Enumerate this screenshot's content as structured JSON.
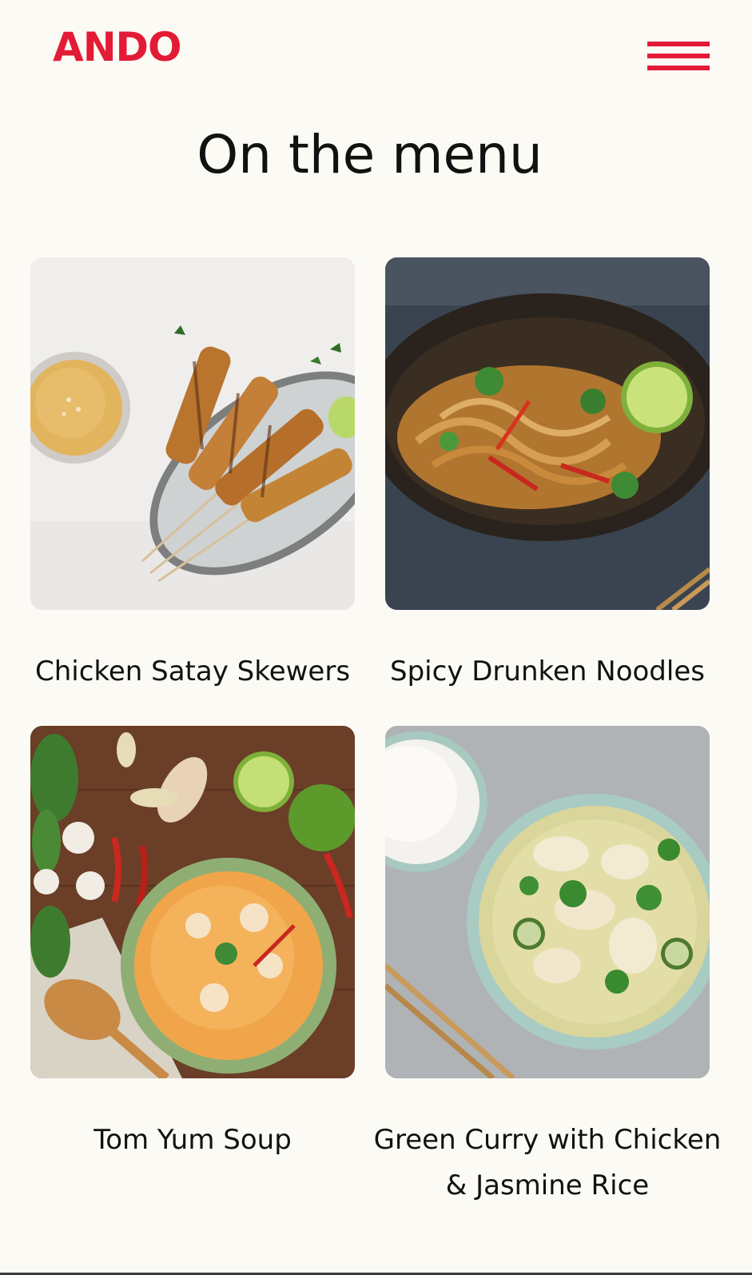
{
  "brand": {
    "logo_text": "ANDO",
    "accent_color": "#e31b36"
  },
  "header": {
    "menu_icon": "hamburger-menu-icon"
  },
  "page": {
    "title": "On the menu"
  },
  "menu_items": [
    {
      "name": "Chicken Satay Skewers",
      "image": "chicken-satay-skewers-photo"
    },
    {
      "name": "Spicy Drunken Noodles",
      "image": "spicy-drunken-noodles-photo"
    },
    {
      "name": "Tom Yum Soup",
      "image": "tom-yum-soup-photo"
    },
    {
      "name": "Green Curry with Chicken & Jasmine Rice",
      "image": "green-curry-photo"
    }
  ]
}
